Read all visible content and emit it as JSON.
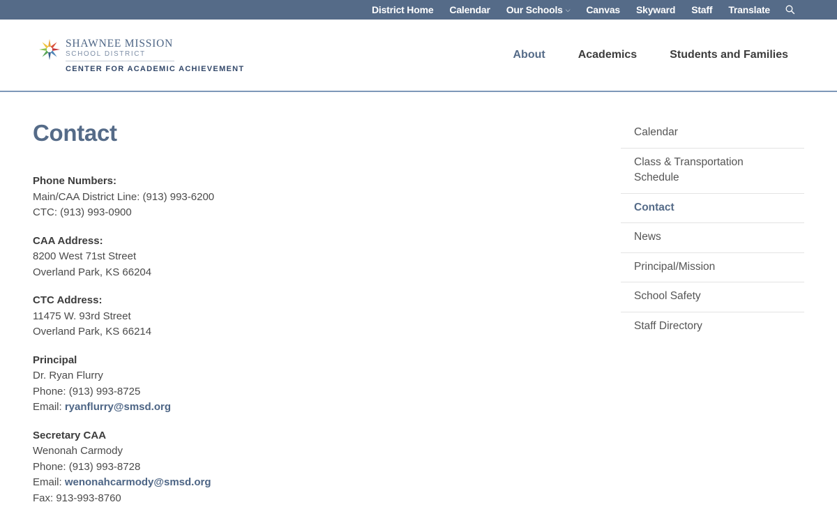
{
  "topnav": {
    "items": [
      {
        "label": "District Home"
      },
      {
        "label": "Calendar"
      },
      {
        "label": "Our Schools",
        "has_dropdown": true
      },
      {
        "label": "Canvas"
      },
      {
        "label": "Skyward"
      },
      {
        "label": "Staff"
      },
      {
        "label": "Translate"
      }
    ],
    "search_icon": "search-icon"
  },
  "logo": {
    "line1": "SHAWNEE MISSION",
    "line2": "SCHOOL DISTRICT",
    "line3": "CENTER FOR ACADEMIC ACHIEVEMENT"
  },
  "mainnav": {
    "items": [
      {
        "label": "About"
      },
      {
        "label": "Academics"
      },
      {
        "label": "Students and Families"
      }
    ]
  },
  "main": {
    "title": "Contact",
    "phone": {
      "label": "Phone Numbers:",
      "line1": "Main/CAA District Line: (913) 993-6200",
      "line2": "CTC: (913) 993-0900"
    },
    "caa_address": {
      "label": "CAA Address:",
      "line1": "8200 West 71st Street",
      "line2": "Overland Park, KS 66204"
    },
    "ctc_address": {
      "label": "CTC Address:",
      "line1": "11475 W. 93rd Street",
      "line2": "Overland Park, KS 66214"
    },
    "principal": {
      "label": "Principal",
      "name": "Dr. Ryan Flurry",
      "phone": "Phone: (913) 993-8725",
      "email_prefix": "Email: ",
      "email": "ryanflurry@smsd.org"
    },
    "secretary": {
      "label": "Secretary CAA",
      "name": "Wenonah Carmody",
      "phone": "Phone: (913) 993-8728",
      "email_prefix": "Email: ",
      "email": "wenonahcarmody@smsd.org",
      "fax": "Fax: 913-993-8760"
    }
  },
  "sidebar": {
    "items": [
      {
        "label": "Calendar"
      },
      {
        "label": "Class & Transportation Schedule"
      },
      {
        "label": "Contact",
        "current": true
      },
      {
        "label": "News"
      },
      {
        "label": "Principal/Mission"
      },
      {
        "label": "School Safety"
      },
      {
        "label": "Staff Directory"
      }
    ]
  },
  "colors": {
    "topbar": "#556b88",
    "accent": "#556b88",
    "link": "#4d6585",
    "header_border": "#7d97b8"
  }
}
